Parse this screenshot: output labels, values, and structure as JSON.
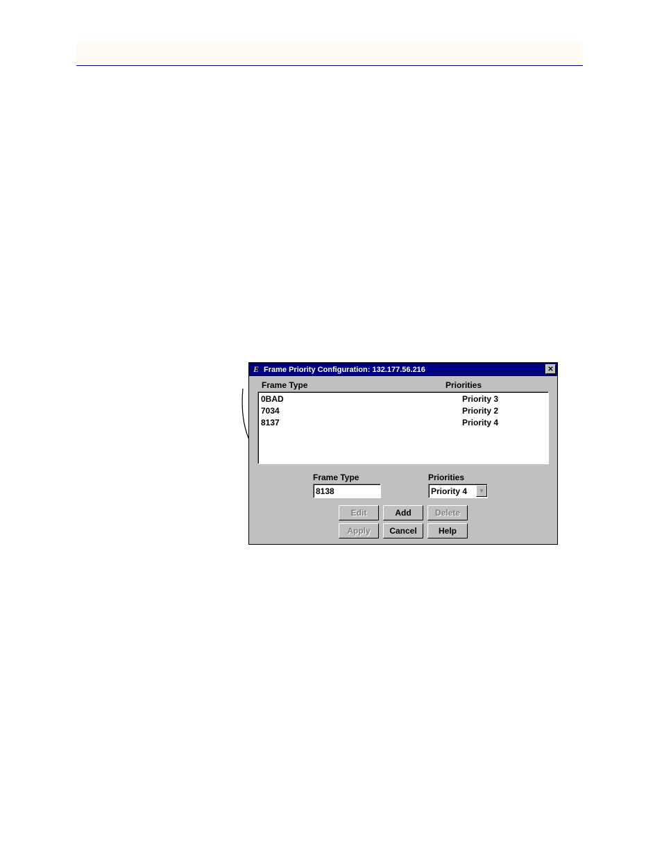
{
  "dialog": {
    "title": "Frame Priority Configuration: 132.177.56.216",
    "headers": {
      "col1": "Frame Type",
      "col2": "Priorities"
    },
    "rows": [
      {
        "type": "0BAD",
        "priority": "Priority 3"
      },
      {
        "type": "7034",
        "priority": "Priority 2"
      },
      {
        "type": "8137",
        "priority": "Priority 4"
      }
    ],
    "input": {
      "frame_label": "Frame Type",
      "frame_value": "8138",
      "priority_label": "Priorities",
      "priority_value": "Priority 4"
    },
    "buttons": {
      "edit": "Edit",
      "add": "Add",
      "delete": "Delete",
      "apply": "Apply",
      "cancel": "Cancel",
      "help": "Help"
    }
  }
}
